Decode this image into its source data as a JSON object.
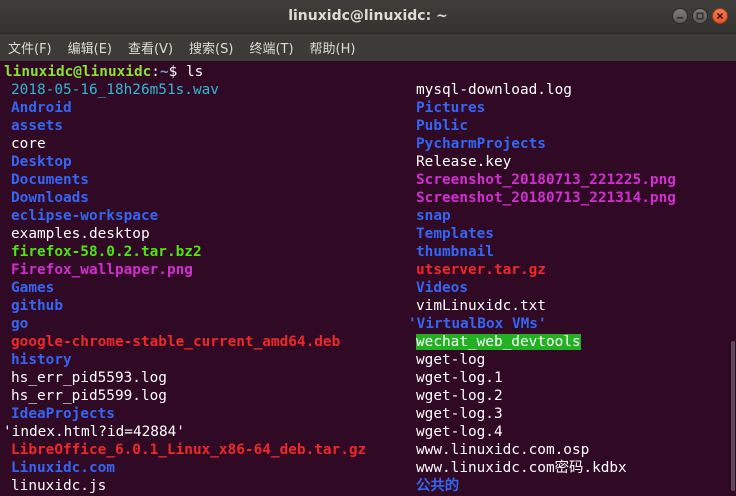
{
  "window": {
    "title": "linuxidc@linuxidc: ~"
  },
  "menu": [
    "文件(F)",
    "编辑(E)",
    "查看(V)",
    "搜索(S)",
    "终端(T)",
    "帮助(H)"
  ],
  "prompt": {
    "user_host": "linuxidc@linuxidc",
    "sep": ":",
    "path": "~",
    "symbol": "$ ",
    "command": "ls"
  },
  "files_left": [
    {
      "name": "2018-05-16_18h26m51s.wav",
      "kind": "media"
    },
    {
      "name": "Android",
      "kind": "dir"
    },
    {
      "name": "assets",
      "kind": "dir"
    },
    {
      "name": "core",
      "kind": "plain"
    },
    {
      "name": "Desktop",
      "kind": "dir"
    },
    {
      "name": "Documents",
      "kind": "dir"
    },
    {
      "name": "Downloads",
      "kind": "dir"
    },
    {
      "name": "eclipse-workspace",
      "kind": "dir"
    },
    {
      "name": "examples.desktop",
      "kind": "plain"
    },
    {
      "name": "firefox-58.0.2.tar.bz2",
      "kind": "exec"
    },
    {
      "name": "Firefox_wallpaper.png",
      "kind": "image"
    },
    {
      "name": "Games",
      "kind": "dir"
    },
    {
      "name": "github",
      "kind": "dir"
    },
    {
      "name": "go",
      "kind": "dir"
    },
    {
      "name": "google-chrome-stable_current_amd64.deb",
      "kind": "archive"
    },
    {
      "name": "history",
      "kind": "dir"
    },
    {
      "name": "hs_err_pid5593.log",
      "kind": "plain"
    },
    {
      "name": "hs_err_pid5599.log",
      "kind": "plain"
    },
    {
      "name": "IdeaProjects",
      "kind": "dir"
    },
    {
      "name": "'index.html?id=42884'",
      "kind": "plain"
    },
    {
      "name": "LibreOffice_6.0.1_Linux_x86-64_deb.tar.gz",
      "kind": "archive"
    },
    {
      "name": "Linuxidc.com",
      "kind": "dir"
    },
    {
      "name": "linuxidc.js",
      "kind": "plain"
    }
  ],
  "files_right": [
    {
      "name": "mysql-download.log",
      "kind": "plain"
    },
    {
      "name": "Pictures",
      "kind": "dir"
    },
    {
      "name": "Public",
      "kind": "dir"
    },
    {
      "name": "PycharmProjects",
      "kind": "dir"
    },
    {
      "name": "Release.key",
      "kind": "plain"
    },
    {
      "name": "Screenshot_20180713_221225.png",
      "kind": "image"
    },
    {
      "name": "Screenshot_20180713_221314.png",
      "kind": "image"
    },
    {
      "name": "snap",
      "kind": "dir"
    },
    {
      "name": "Templates",
      "kind": "dir"
    },
    {
      "name": "thumbnail",
      "kind": "dir"
    },
    {
      "name": "utserver.tar.gz",
      "kind": "archive"
    },
    {
      "name": "Videos",
      "kind": "dir"
    },
    {
      "name": "vimLinuxidc.txt",
      "kind": "plain"
    },
    {
      "name": "'VirtualBox VMs'",
      "kind": "dir"
    },
    {
      "name": "wechat_web_devtools",
      "kind": "hl"
    },
    {
      "name": "wget-log",
      "kind": "plain"
    },
    {
      "name": "wget-log.1",
      "kind": "plain"
    },
    {
      "name": "wget-log.2",
      "kind": "plain"
    },
    {
      "name": "wget-log.3",
      "kind": "plain"
    },
    {
      "name": "wget-log.4",
      "kind": "plain"
    },
    {
      "name": "www.linuxidc.com.osp",
      "kind": "plain"
    },
    {
      "name": "www.linuxidc.com密码.kdbx",
      "kind": "plain"
    },
    {
      "name": "公共的",
      "kind": "dir"
    }
  ],
  "colors": {
    "background": "#300a24",
    "prompt_user": "#8ae234",
    "prompt_path": "#729fcf",
    "directory": "#3465f4",
    "executable": "#4ee60f",
    "archive": "#ef2929",
    "image": "#d22fd2",
    "media": "#34b6d4",
    "highlight_bg": "#23b023"
  },
  "icons": {
    "minimize": "minimize-icon",
    "maximize": "maximize-icon",
    "close": "close-icon"
  }
}
